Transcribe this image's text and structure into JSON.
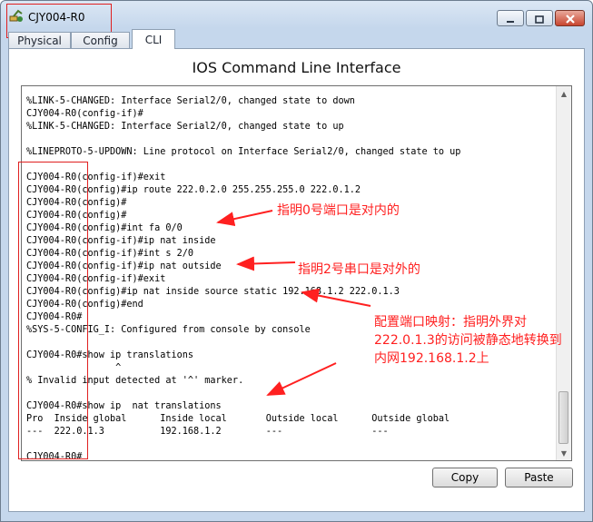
{
  "window": {
    "title": "CJY004-R0"
  },
  "tabs": [
    {
      "label": "Physical"
    },
    {
      "label": "Config"
    },
    {
      "label": "CLI"
    }
  ],
  "active_tab": "CLI",
  "cli": {
    "heading": "IOS Command Line Interface",
    "lines": [
      "%LINK-5-CHANGED: Interface Serial2/0, changed state to down",
      "CJY004-R0(config-if)#",
      "%LINK-5-CHANGED: Interface Serial2/0, changed state to up",
      "",
      "%LINEPROTO-5-UPDOWN: Line protocol on Interface Serial2/0, changed state to up",
      "",
      "CJY004-R0(config-if)#exit",
      "CJY004-R0(config)#ip route 222.0.2.0 255.255.255.0 222.0.1.2",
      "CJY004-R0(config)#",
      "CJY004-R0(config)#",
      "CJY004-R0(config)#int fa 0/0",
      "CJY004-R0(config-if)#ip nat inside",
      "CJY004-R0(config-if)#int s 2/0",
      "CJY004-R0(config-if)#ip nat outside",
      "CJY004-R0(config-if)#exit",
      "CJY004-R0(config)#ip nat inside source static 192.168.1.2 222.0.1.3",
      "CJY004-R0(config)#end",
      "CJY004-R0#",
      "%SYS-5-CONFIG_I: Configured from console by console",
      "",
      "CJY004-R0#show ip translations",
      "                ^",
      "% Invalid input detected at '^' marker.",
      "",
      "CJY004-R0#show ip  nat translations",
      "Pro  Inside global      Inside local       Outside local      Outside global",
      "---  222.0.1.3          192.168.1.2        ---                ---",
      "",
      "CJY004-R0#"
    ]
  },
  "annotations": [
    "指明0号端口是对内的",
    "指明2号串口是对外的",
    "配置端口映射：指明外界对",
    "222.0.1.3的访问被静态地转换到",
    "内网192.168.1.2上"
  ],
  "buttons": {
    "copy": "Copy",
    "paste": "Paste"
  },
  "colors": {
    "annotation": "#ff2020",
    "highlight_box": "#e02020",
    "window_frame": "#c5d7ec"
  },
  "icons": {
    "app": "router-app-icon",
    "minimize": "minimize-icon",
    "maximize": "maximize-icon",
    "close": "close-icon"
  }
}
